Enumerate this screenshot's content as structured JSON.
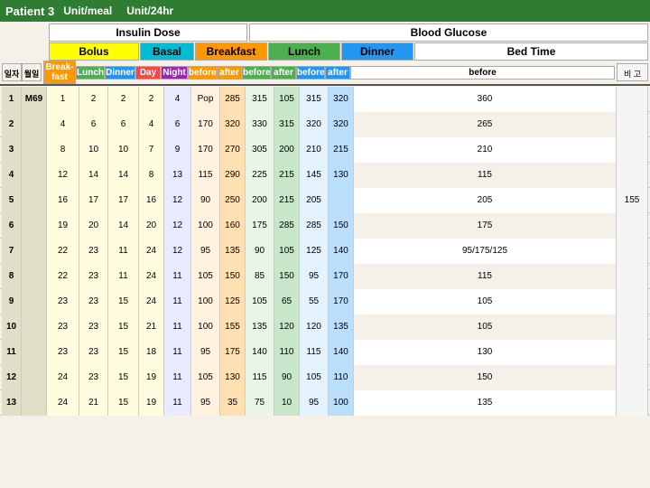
{
  "topBar": {
    "patientLabel": "Patient 3",
    "unitMeal": "Unit/meal",
    "unit24hr": "Unit/24hr"
  },
  "headers": {
    "insulinDose": "Insulin Dose",
    "bloodGlucose": "Blood Glucose",
    "bolus": "Bolus",
    "basal": "Basal",
    "breakfast": "Breakfast",
    "lunch": "Lunch",
    "dinner": "Dinner",
    "bedTime": "Bed Time",
    "subHeaders": [
      "Break-fast",
      "Lunch",
      "Dinner",
      "Day",
      "Night",
      "before",
      "after",
      "before",
      "after",
      "before",
      "after",
      "before"
    ],
    "remarkLabel": "비 고"
  },
  "rows": [
    {
      "num": 1,
      "day": 2,
      "bf": 1,
      "lunch": 2,
      "dinner": 2,
      "night": 4,
      "bfBefore": "Pop",
      "bfAfter": 285,
      "lBefore": 315,
      "lAfter": 105,
      "dBefore": 315,
      "dAfter": 320,
      "bt": 360,
      "remark": ""
    },
    {
      "num": 2,
      "day": 4,
      "bf": 4,
      "lunch": 6,
      "dinner": 6,
      "night": 6,
      "bfBefore": 170,
      "bfAfter": 320,
      "lBefore": 330,
      "lAfter": 315,
      "dBefore": 320,
      "dAfter": 320,
      "bt": 265,
      "remark": ""
    },
    {
      "num": 3,
      "day": 7,
      "bf": 8,
      "lunch": 10,
      "dinner": 10,
      "night": 9,
      "bfBefore": 170,
      "bfAfter": 270,
      "lBefore": 305,
      "lAfter": 200,
      "dBefore": 210,
      "dAfter": 215,
      "bt": 210,
      "remark": ""
    },
    {
      "num": 4,
      "day": 8,
      "bf": 12,
      "lunch": 14,
      "dinner": 14,
      "night": 13,
      "bfBefore": 115,
      "bfAfter": 290,
      "lBefore": 225,
      "lAfter": 215,
      "dBefore": 145,
      "dAfter": 130,
      "bt": 115,
      "remark": ""
    },
    {
      "num": 5,
      "day": 16,
      "bf": 16,
      "lunch": 17,
      "dinner": 17,
      "night": 12,
      "bfBefore": 90,
      "bfAfter": 250,
      "lBefore": 200,
      "lAfter": 215,
      "dBefore": 205,
      "dAfter": "",
      "bt": 205,
      "remark": "155"
    },
    {
      "num": 6,
      "day": 20,
      "bf": 19,
      "lunch": 20,
      "dinner": 14,
      "night": 12,
      "bfBefore": 100,
      "bfAfter": 160,
      "lBefore": 175,
      "lAfter": 285,
      "dBefore": 285,
      "dAfter": 150,
      "bt": 175,
      "remark": ""
    },
    {
      "num": 7,
      "day": 24,
      "bf": 22,
      "lunch": 23,
      "dinner": 11,
      "night": 12,
      "bfBefore": 95,
      "bfAfter": 135,
      "lBefore": 90,
      "lAfter": 105,
      "dBefore": 125,
      "dAfter": 140,
      "bt": "95/175/125",
      "remark": ""
    },
    {
      "num": 8,
      "day": 24,
      "bf": 22,
      "lunch": 23,
      "dinner": 11,
      "night": 11,
      "bfBefore": 105,
      "bfAfter": 150,
      "lBefore": 85,
      "lAfter": 150,
      "dBefore": 95,
      "dAfter": 170,
      "bt": 115,
      "remark": ""
    },
    {
      "num": 9,
      "day": 24,
      "bf": 23,
      "lunch": 23,
      "dinner": 15,
      "night": 11,
      "bfBefore": 100,
      "bfAfter": 125,
      "lBefore": 105,
      "lAfter": "65",
      "dBefore": 55,
      "dAfter": 170,
      "bt": 105,
      "remark": ""
    },
    {
      "num": 10,
      "day": 21,
      "bf": 23,
      "lunch": 23,
      "dinner": 15,
      "night": 11,
      "bfBefore": 100,
      "bfAfter": 155,
      "lBefore": 135,
      "lAfter": 120,
      "dBefore": 120,
      "dAfter": 135,
      "bt": 105,
      "remark": ""
    },
    {
      "num": 11,
      "day": 18,
      "bf": 23,
      "lunch": 23,
      "dinner": 15,
      "night": 11,
      "bfBefore": 95,
      "bfAfter": 175,
      "lBefore": 140,
      "lAfter": 110,
      "dBefore": 115,
      "dAfter": 140,
      "bt": 130,
      "remark": ""
    },
    {
      "num": 12,
      "day": 19,
      "bf": 24,
      "lunch": 23,
      "dinner": 15,
      "night": 11,
      "bfBefore": 105,
      "bfAfter": 130,
      "lBefore": 115,
      "lAfter": 90,
      "dBefore": 105,
      "dAfter": 110,
      "bt": 150,
      "remark": ""
    },
    {
      "num": 13,
      "day": 19,
      "bf": 24,
      "lunch": 21,
      "dinner": 15,
      "night": 11,
      "bfBefore": 95,
      "bfAfter": 35,
      "lBefore": 75,
      "lAfter": 10,
      "dBefore": 95,
      "dAfter": 100,
      "bt": 135,
      "remark": ""
    }
  ]
}
